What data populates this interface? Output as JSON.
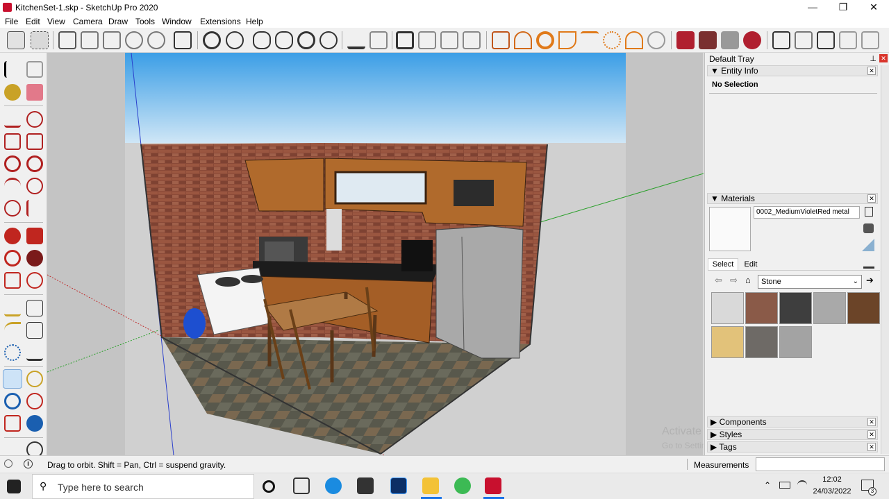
{
  "window": {
    "title": "KitchenSet-1.skp - SketchUp Pro 2020",
    "minimize": "—",
    "restore": "❐",
    "close": "✕"
  },
  "menu": [
    "File",
    "Edit",
    "View",
    "Camera",
    "Draw",
    "Tools",
    "Window",
    "Extensions",
    "Help"
  ],
  "tray": {
    "title": "Default Tray",
    "entity_info": {
      "header": "Entity Info",
      "selection": "No Selection"
    },
    "materials": {
      "header": "Materials",
      "material_name": "0002_MediumVioletRed metal",
      "tabs": [
        "Select",
        "Edit"
      ],
      "library": "Stone",
      "swatch_colors": [
        "#d9d9d9",
        "#8a5a48",
        "#3e3e3e",
        "#a9a9a9",
        "#6b4428",
        "#e2c27a",
        "#6e6a66",
        "#a3a3a3"
      ]
    },
    "collapsed_panels": [
      "Components",
      "Styles",
      "Tags"
    ]
  },
  "watermark": {
    "line1": "Activate Windows",
    "line2": "Go to Settings to activate Windows."
  },
  "status": {
    "message": "Drag to orbit. Shift = Pan, Ctrl = suspend gravity.",
    "measurements_label": "Measurements",
    "measurements_value": ""
  },
  "taskbar": {
    "search_placeholder": "Type here to search",
    "time": "12:02",
    "date": "24/03/2022",
    "notification_count": "3"
  },
  "colors": {
    "accent": "#c8102e",
    "sky": "#3b9ee6",
    "ground": "#c4c4c4",
    "brick": "#8a4a38",
    "cabinet": "#b06a2c"
  }
}
